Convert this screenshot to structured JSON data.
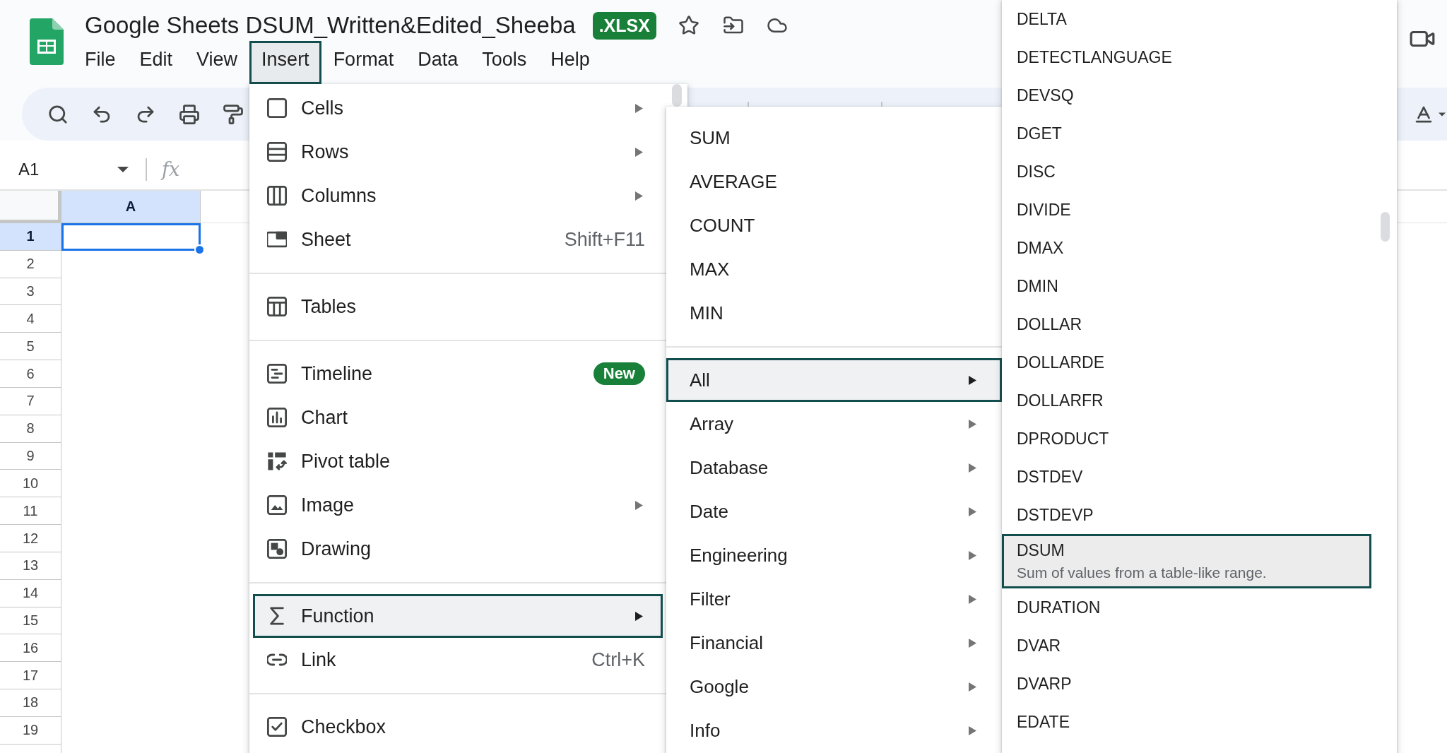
{
  "document": {
    "title": "Google Sheets DSUM_Written&Edited_Sheeba",
    "format_badge": ".XLSX"
  },
  "menu_bar": [
    {
      "label": "File",
      "selected": false
    },
    {
      "label": "Edit",
      "selected": false
    },
    {
      "label": "View",
      "selected": false
    },
    {
      "label": "Insert",
      "selected": true
    },
    {
      "label": "Format",
      "selected": false
    },
    {
      "label": "Data",
      "selected": false
    },
    {
      "label": "Tools",
      "selected": false
    },
    {
      "label": "Help",
      "selected": false
    }
  ],
  "formula_bar": {
    "cell_reference": "A1",
    "function_label": "fx"
  },
  "grid": {
    "columns": [
      {
        "label": "A",
        "selected": true
      }
    ],
    "rows": [
      {
        "label": "1",
        "selected": true
      },
      {
        "label": "2",
        "selected": false
      },
      {
        "label": "3",
        "selected": false
      },
      {
        "label": "4",
        "selected": false
      },
      {
        "label": "5",
        "selected": false
      },
      {
        "label": "6",
        "selected": false
      },
      {
        "label": "7",
        "selected": false
      },
      {
        "label": "8",
        "selected": false
      },
      {
        "label": "9",
        "selected": false
      },
      {
        "label": "10",
        "selected": false
      },
      {
        "label": "11",
        "selected": false
      },
      {
        "label": "12",
        "selected": false
      },
      {
        "label": "13",
        "selected": false
      },
      {
        "label": "14",
        "selected": false
      },
      {
        "label": "15",
        "selected": false
      },
      {
        "label": "16",
        "selected": false
      },
      {
        "label": "17",
        "selected": false
      },
      {
        "label": "18",
        "selected": false
      },
      {
        "label": "19",
        "selected": false
      }
    ]
  },
  "insert_menu": {
    "sections": [
      {
        "items": [
          {
            "label": "Cells",
            "submenu": true,
            "selected": false
          },
          {
            "label": "Rows",
            "submenu": true,
            "selected": false
          },
          {
            "label": "Columns",
            "submenu": true,
            "selected": false
          },
          {
            "label": "Sheet",
            "shortcut": "Shift+F11",
            "submenu": false,
            "selected": false
          }
        ]
      },
      {
        "items": [
          {
            "label": "Tables",
            "submenu": false,
            "selected": false
          }
        ]
      },
      {
        "items": [
          {
            "label": "Timeline",
            "badge": "New",
            "submenu": false,
            "selected": false
          },
          {
            "label": "Chart",
            "submenu": false,
            "selected": false
          },
          {
            "label": "Pivot table",
            "submenu": false,
            "selected": false
          },
          {
            "label": "Image",
            "submenu": true,
            "selected": false
          },
          {
            "label": "Drawing",
            "submenu": false,
            "selected": false
          }
        ]
      },
      {
        "items": [
          {
            "label": "Function",
            "submenu": true,
            "selected": true
          },
          {
            "label": "Link",
            "shortcut": "Ctrl+K",
            "submenu": false,
            "selected": false
          }
        ]
      },
      {
        "items": [
          {
            "label": "Checkbox",
            "submenu": false,
            "selected": false
          }
        ]
      }
    ]
  },
  "function_menu": {
    "sections": [
      {
        "items": [
          {
            "label": "SUM",
            "submenu": false,
            "selected": false
          },
          {
            "label": "AVERAGE",
            "submenu": false,
            "selected": false
          },
          {
            "label": "COUNT",
            "submenu": false,
            "selected": false
          },
          {
            "label": "MAX",
            "submenu": false,
            "selected": false
          },
          {
            "label": "MIN",
            "submenu": false,
            "selected": false
          }
        ]
      },
      {
        "items": [
          {
            "label": "All",
            "submenu": true,
            "selected": true
          },
          {
            "label": "Array",
            "submenu": true,
            "selected": false
          },
          {
            "label": "Database",
            "submenu": true,
            "selected": false
          },
          {
            "label": "Date",
            "submenu": true,
            "selected": false
          },
          {
            "label": "Engineering",
            "submenu": true,
            "selected": false
          },
          {
            "label": "Filter",
            "submenu": true,
            "selected": false
          },
          {
            "label": "Financial",
            "submenu": true,
            "selected": false
          },
          {
            "label": "Google",
            "submenu": true,
            "selected": false
          },
          {
            "label": "Info",
            "submenu": true,
            "selected": false
          }
        ]
      }
    ]
  },
  "all_functions_menu": {
    "items": [
      {
        "label": "DELTA",
        "selected": false
      },
      {
        "label": "DETECTLANGUAGE",
        "selected": false
      },
      {
        "label": "DEVSQ",
        "selected": false
      },
      {
        "label": "DGET",
        "selected": false
      },
      {
        "label": "DISC",
        "selected": false
      },
      {
        "label": "DIVIDE",
        "selected": false
      },
      {
        "label": "DMAX",
        "selected": false
      },
      {
        "label": "DMIN",
        "selected": false
      },
      {
        "label": "DOLLAR",
        "selected": false
      },
      {
        "label": "DOLLARDE",
        "selected": false
      },
      {
        "label": "DOLLARFR",
        "selected": false
      },
      {
        "label": "DPRODUCT",
        "selected": false
      },
      {
        "label": "DSTDEV",
        "selected": false
      },
      {
        "label": "DSTDEVP",
        "selected": false
      },
      {
        "label": "DSUM",
        "description": "Sum of values from a table-like range.",
        "selected": true
      },
      {
        "label": "DURATION",
        "selected": false
      },
      {
        "label": "DVAR",
        "selected": false
      },
      {
        "label": "DVARP",
        "selected": false
      },
      {
        "label": "EDATE",
        "selected": false
      }
    ]
  }
}
